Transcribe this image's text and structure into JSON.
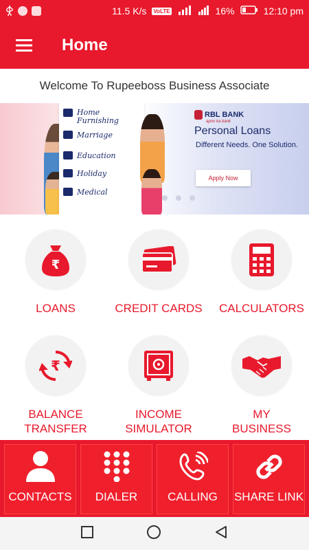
{
  "status": {
    "speed": "11.5 K/s",
    "volte": "VoLTE",
    "network": "4G",
    "battery": "16%",
    "time": "12:10 pm"
  },
  "app_bar": {
    "title": "Home"
  },
  "welcome": "Welcome To Rupeeboss Business Associate",
  "banner": {
    "items": [
      "Home Furnishing",
      "Marriage",
      "Education",
      "Holiday",
      "Medical"
    ],
    "brand": "RBL BANK",
    "brand_tag": "apno ka bank",
    "headline": "Personal Loans",
    "subline": "Different Needs. One Solution.",
    "cta": "Apply Now"
  },
  "tiles": [
    {
      "label": "LOANS",
      "icon": "money-bag-icon"
    },
    {
      "label": "CREDIT CARDS",
      "icon": "credit-card-icon"
    },
    {
      "label": "CALCULATORS",
      "icon": "calculator-icon"
    },
    {
      "label_line1": "BALANCE",
      "label_line2": "TRANSFER",
      "icon": "rupee-refresh-icon"
    },
    {
      "label_line1": "INCOME",
      "label_line2": "SIMULATOR",
      "icon": "safe-icon"
    },
    {
      "label_line1": "MY",
      "label_line2": "BUSINESS",
      "icon": "handshake-icon"
    }
  ],
  "bottom": [
    {
      "label": "CONTACTS",
      "icon": "person-icon"
    },
    {
      "label": "DIALER",
      "icon": "dialpad-icon"
    },
    {
      "label": "CALLING",
      "icon": "phone-ringing-icon"
    },
    {
      "label": "SHARE LINK",
      "icon": "link-icon"
    }
  ],
  "colors": {
    "primary": "#e8192c",
    "tile_bg": "#f2f2f2",
    "banner_text": "#1b2a6b"
  }
}
